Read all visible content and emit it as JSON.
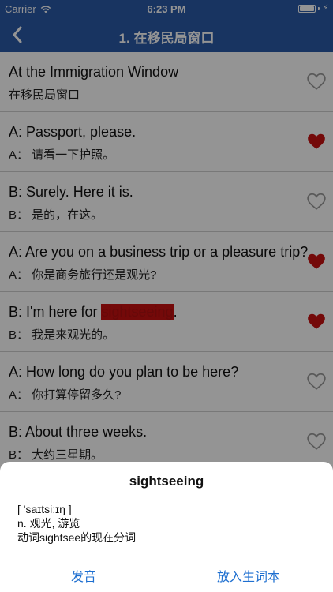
{
  "status": {
    "carrier": "Carrier",
    "time": "6:23 PM"
  },
  "nav": {
    "title": "1. 在移民局窗口"
  },
  "rows": [
    {
      "en": "At the Immigration Window",
      "zh": "在移民局窗口",
      "favorite": false
    },
    {
      "en": "A: Passport, please.",
      "zh": "A： 请看一下护照。",
      "favorite": true
    },
    {
      "en": "B: Surely. Here it is.",
      "zh": "B： 是的，在这。",
      "favorite": false
    },
    {
      "en": "A: Are you on a business trip or a pleasure trip?",
      "zh": "A： 你是商务旅行还是观光?",
      "favorite": true
    },
    {
      "en_before": "B: I'm here for ",
      "en_highlight": "sightseeing",
      "en_after": ".",
      "zh": "B： 我是来观光的。",
      "favorite": true
    },
    {
      "en": "A: How long do you plan to be here?",
      "zh": "A： 你打算停留多久?",
      "favorite": false
    },
    {
      "en": "B: About three weeks.",
      "zh": "B： 大约三星期。",
      "favorite": false
    }
  ],
  "sheet": {
    "word": "sightseeing",
    "phonetic": "[ 'saɪtsiːɪŋ ]",
    "definition": "n. 观光, 游览",
    "note": "动词sightsee的现在分词",
    "action_pronounce": "发音",
    "action_add": "放入生词本"
  },
  "colors": {
    "nav": "#2a5aa8",
    "heart": "#c81010",
    "link": "#1e6fd0"
  }
}
